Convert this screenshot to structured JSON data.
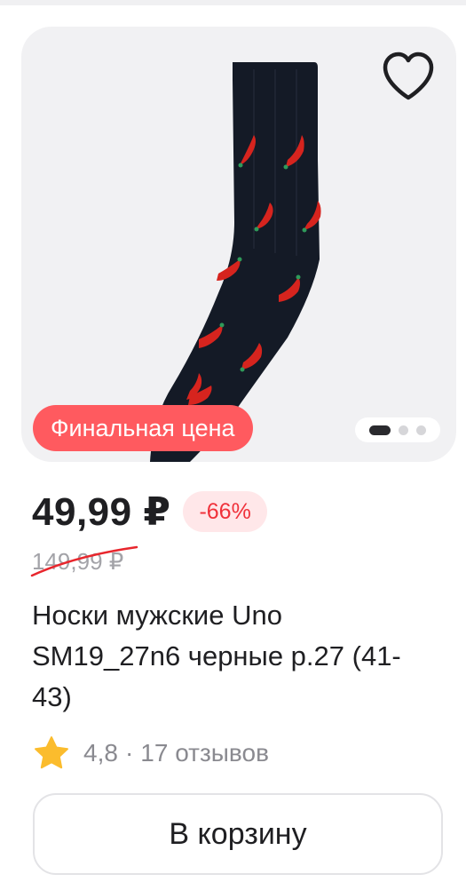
{
  "product": {
    "image_alt": "black socks with red chili pepper pattern",
    "badge": "Финальная цена",
    "carousel": {
      "total": 3,
      "active": 1
    },
    "price": "49,99 ₽",
    "discount": "-66%",
    "old_price": "149,99 ₽",
    "title": "Носки мужские Uno SM19_27n6 черные р.27 (41-43)",
    "rating": "4,8",
    "rating_separator": "·",
    "reviews": "17 отзывов",
    "cart_button": "В корзину"
  },
  "icons": {
    "favorite": "heart-outline-icon",
    "rating": "star-icon"
  },
  "colors": {
    "accent": "#ff5a5f",
    "discount_text": "#f0313a",
    "discount_bg": "#ffe7e9",
    "star": "#fbbc2d",
    "sock": "#141a26",
    "pepper": "#d6241e"
  }
}
